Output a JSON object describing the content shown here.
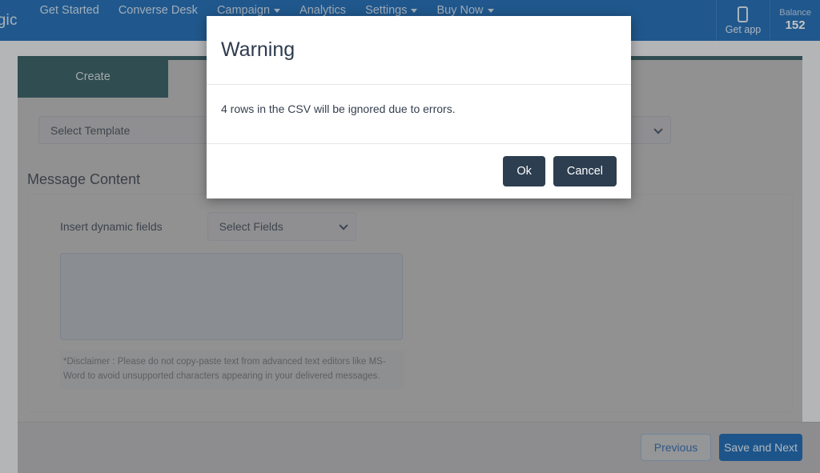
{
  "navbar": {
    "brand": "agic",
    "items": [
      {
        "label": "Get Started",
        "has_caret": false
      },
      {
        "label": "Converse Desk",
        "has_caret": false
      },
      {
        "label": "Campaign",
        "has_caret": true
      },
      {
        "label": "Analytics",
        "has_caret": false
      },
      {
        "label": "Settings",
        "has_caret": true
      },
      {
        "label": "Buy Now",
        "has_caret": true
      }
    ],
    "get_app_label": "Get app",
    "get_app_icon": "mobile-phone-icon",
    "balance_label": "Balance",
    "balance_value": "152",
    "background_color": "#1565b0"
  },
  "tabs": {
    "active": "Create",
    "items": [
      {
        "label": "Create"
      }
    ],
    "background_color": "#2b555c"
  },
  "form": {
    "template_select": {
      "value": "Select Template",
      "icon": "chevron-down-icon"
    },
    "section_title": "Message Content",
    "dynamic_fields_label": "Insert dynamic fields",
    "fields_select": {
      "value": "Select Fields",
      "icon": "chevron-down-icon"
    },
    "message_textarea": {
      "value": "",
      "placeholder": ""
    },
    "disclaimer": "*Disclaimer : Please do not copy-paste text from advanced text editors like MS-Word to avoid unsupported characters appearing in your delivered messages."
  },
  "footer": {
    "previous_label": "Previous",
    "save_next_label": "Save and Next",
    "primary_color": "#1160ad"
  },
  "modal": {
    "title": "Warning",
    "message": "4 rows in the CSV will be ignored due to errors.",
    "ok_label": "Ok",
    "cancel_label": "Cancel",
    "button_color": "#2c3e50"
  }
}
